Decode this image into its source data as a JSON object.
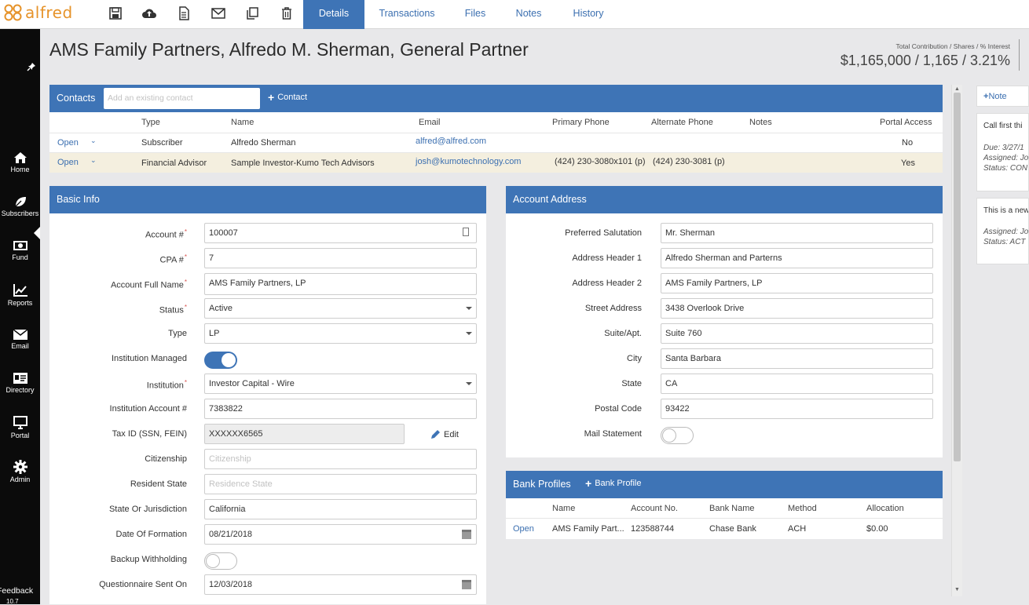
{
  "app": {
    "logo_text": "alfred"
  },
  "toolbar": {
    "icons": [
      "save-icon",
      "cloud-upload-icon",
      "document-icon",
      "email-icon",
      "copy-icon",
      "trash-icon"
    ]
  },
  "tabs": [
    {
      "label": "Details",
      "active": true
    },
    {
      "label": "Transactions",
      "active": false
    },
    {
      "label": "Files",
      "active": false
    },
    {
      "label": "Notes",
      "active": false
    },
    {
      "label": "History",
      "active": false
    }
  ],
  "sidebar": {
    "items": [
      {
        "label": "Home",
        "icon": "home-icon"
      },
      {
        "label": "Subscribers",
        "icon": "leaf-icon"
      },
      {
        "label": "Fund",
        "icon": "money-icon"
      },
      {
        "label": "Reports",
        "icon": "chart-icon"
      },
      {
        "label": "Email",
        "icon": "envelope-icon"
      },
      {
        "label": "Directory",
        "icon": "contact-card-icon"
      },
      {
        "label": "Portal",
        "icon": "monitor-icon"
      },
      {
        "label": "Admin",
        "icon": "gear-icon"
      }
    ],
    "feedback_label": "Feedback",
    "version": "10.7"
  },
  "page": {
    "title": "AMS Family Partners, Alfredo M. Sherman, General Partner",
    "summary_label": "Total Contribution / Shares / % Interest",
    "summary_value": "$1,165,000 / 1,165 / 3.21%"
  },
  "contacts": {
    "title": "Contacts",
    "search_placeholder": "Add an existing contact",
    "add_label": "Contact",
    "columns": [
      "Type",
      "Name",
      "Email",
      "Primary Phone",
      "Alternate Phone",
      "Notes",
      "Portal Access"
    ],
    "rows": [
      {
        "open": "Open",
        "type": "Subscriber",
        "name": "Alfredo Sherman",
        "email": "alfred@alfred.com",
        "primary": "",
        "alternate": "",
        "notes": "",
        "portal": "No"
      },
      {
        "open": "Open",
        "type": "Financial Advisor",
        "name": "Sample Investor-Kumo Tech Advisors",
        "email": "josh@kumotechnology.com",
        "primary": "(424) 230-3080x101 (p)",
        "alternate": "(424) 230-3081 (p)",
        "notes": "",
        "portal": "Yes"
      }
    ]
  },
  "basic_info": {
    "title": "Basic Info",
    "fields": {
      "account_num": {
        "label": "Account #",
        "value": "100007"
      },
      "cpa_num": {
        "label": "CPA #",
        "value": "7"
      },
      "full_name": {
        "label": "Account Full Name",
        "value": "AMS Family Partners, LP"
      },
      "status": {
        "label": "Status",
        "value": "Active"
      },
      "type": {
        "label": "Type",
        "value": "LP"
      },
      "inst_managed": {
        "label": "Institution Managed",
        "on": true
      },
      "institution": {
        "label": "Institution",
        "value": "Investor Capital - Wire"
      },
      "inst_account": {
        "label": "Institution Account #",
        "value": "7383822"
      },
      "tax_id": {
        "label": "Tax ID (SSN, FEIN)",
        "value": "XXXXXX6565",
        "edit_label": "Edit"
      },
      "citizenship": {
        "label": "Citizenship",
        "placeholder": "Citizenship"
      },
      "resident_state": {
        "label": "Resident State",
        "placeholder": "Residence State"
      },
      "jurisdiction": {
        "label": "State Or Jurisdiction",
        "value": "California"
      },
      "formation_date": {
        "label": "Date Of Formation",
        "value": "08/21/2018"
      },
      "backup_withholding": {
        "label": "Backup Withholding",
        "on": false
      },
      "questionnaire": {
        "label": "Questionnaire Sent On",
        "value": "12/03/2018"
      }
    }
  },
  "account_address": {
    "title": "Account Address",
    "fields": {
      "salutation": {
        "label": "Preferred Salutation",
        "value": "Mr. Sherman"
      },
      "header1": {
        "label": "Address Header 1",
        "value": "Alfredo Sherman and Parterns"
      },
      "header2": {
        "label": "Address Header 2",
        "value": "AMS Family Partners, LP"
      },
      "street": {
        "label": "Street Address",
        "value": "3438 Overlook Drive"
      },
      "suite": {
        "label": "Suite/Apt.",
        "value": "Suite 760"
      },
      "city": {
        "label": "City",
        "value": "Santa Barbara"
      },
      "state": {
        "label": "State",
        "value": "CA"
      },
      "postal": {
        "label": "Postal Code",
        "value": "93422"
      },
      "mail_statement": {
        "label": "Mail Statement",
        "on": false
      }
    }
  },
  "bank_profiles": {
    "title": "Bank Profiles",
    "add_label": "Bank Profile",
    "columns": [
      "Name",
      "Account No.",
      "Bank Name",
      "Method",
      "Allocation"
    ],
    "rows": [
      {
        "open": "Open",
        "name": "AMS Family Part...",
        "account": "123588744",
        "bank": "Chase Bank",
        "method": "ACH",
        "allocation": "$0.00"
      }
    ]
  },
  "notes_panel": {
    "add_label": "Note",
    "cards": [
      {
        "text": "Call first thi",
        "due": "Due: 3/27/1",
        "assigned": "Assigned: Jo",
        "status": "Status: CON"
      },
      {
        "text": "This is a new",
        "assigned": "Assigned: Jo",
        "status": "Status: ACT"
      }
    ]
  },
  "colors": {
    "accent": "#3e74b6",
    "sidebar": "#0b0b0b",
    "logo": "#e6932a",
    "link": "#3b6fb0"
  }
}
